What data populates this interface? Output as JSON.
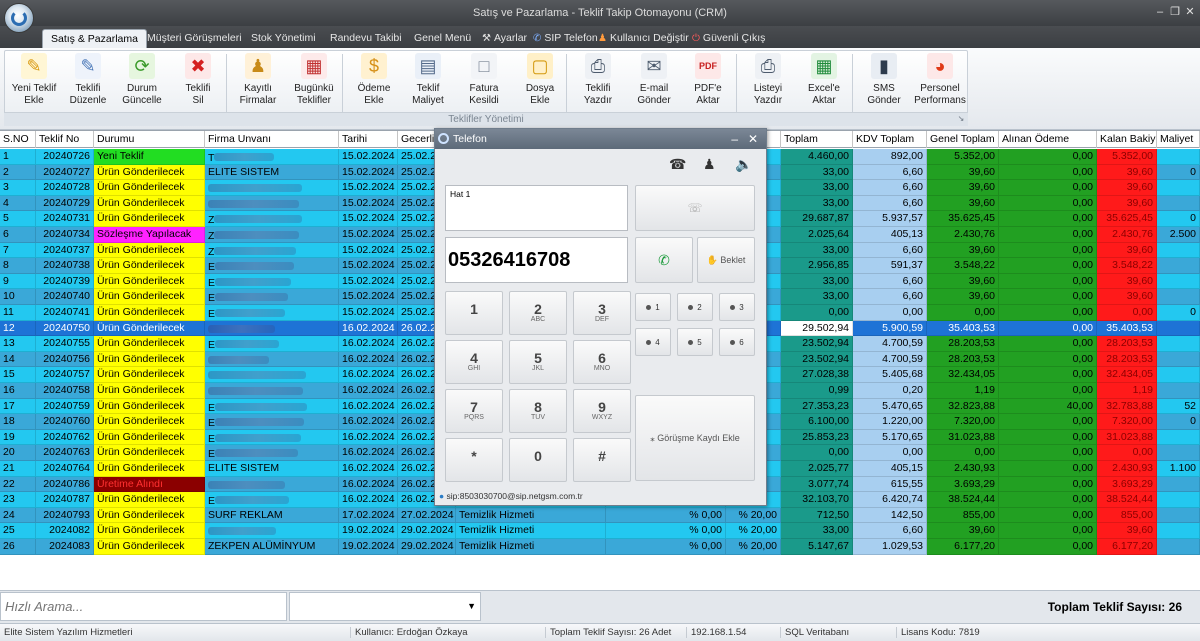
{
  "app": {
    "window_title": "Satış ve Pazarlama - Teklif Takip Otomayonu (CRM)",
    "accent": "#3b3e42"
  },
  "menu": {
    "tabs": [
      {
        "label": "Satış & Pazarlama",
        "active": true
      },
      {
        "label": "Müşteri Görüşmeleri"
      },
      {
        "label": "Stok Yönetimi"
      },
      {
        "label": "Randevu Takibi"
      },
      {
        "label": "Genel Menü"
      }
    ],
    "settings_label": "Ayarlar",
    "sip_label": "SIP Telefon",
    "switch_user_label": "Kullanıcı Değiştir",
    "logout_label": "Güvenli Çıkış"
  },
  "ribbon": {
    "group_caption": "Teklifler Yönetimi",
    "buttons": [
      {
        "label1": "Yeni Teklif",
        "label2": "Ekle",
        "icon": "add-document-icon"
      },
      {
        "label1": "Teklifi",
        "label2": "Düzenle",
        "icon": "pencil-icon"
      },
      {
        "label1": "Durum",
        "label2": "Güncelle",
        "icon": "refresh-icon"
      },
      {
        "label1": "Teklifi",
        "label2": "Sil",
        "icon": "delete-icon"
      },
      {
        "label1": "Kayıtlı",
        "label2": "Firmalar",
        "icon": "users-icon"
      },
      {
        "label1": "Bugünkü",
        "label2": "Teklifler",
        "icon": "calendar-icon"
      },
      {
        "label1": "Ödeme",
        "label2": "Ekle",
        "icon": "money-icon"
      },
      {
        "label1": "Teklif",
        "label2": "Maliyet",
        "icon": "calculator-icon"
      },
      {
        "label1": "Fatura",
        "label2": "Kesildi",
        "icon": "invoice-icon"
      },
      {
        "label1": "Dosya",
        "label2": "Ekle",
        "icon": "folder-icon"
      },
      {
        "label1": "Teklifi",
        "label2": "Yazdır",
        "icon": "print-icon"
      },
      {
        "label1": "E-mail",
        "label2": "Gönder",
        "icon": "email-icon"
      },
      {
        "label1": "PDF'e",
        "label2": "Aktar",
        "icon": "pdf-icon"
      },
      {
        "label1": "Listeyi",
        "label2": "Yazdır",
        "icon": "print-list-icon"
      },
      {
        "label1": "Excel'e",
        "label2": "Aktar",
        "icon": "excel-icon"
      },
      {
        "label1": "SMS",
        "label2": "Gönder",
        "icon": "phone-icon"
      },
      {
        "label1": "Personel",
        "label2": "Performans",
        "icon": "pie-chart-icon"
      }
    ]
  },
  "grid": {
    "columns": [
      "S.NO",
      "Teklif No",
      "Durumu",
      "Firma Unvanı",
      "Tarihi",
      "Gecerlil",
      "",
      "",
      "",
      "Toplam",
      "KDV Toplam",
      "Genel Toplam",
      "Alınan Ödeme",
      "Kalan Bakiye",
      "Maliyet"
    ],
    "rows": [
      {
        "sno": "1",
        "no": "20240726",
        "durum": "Yeni Teklif",
        "firma": "T",
        "tarih": "15.02.2024",
        "gec": "25.02.2",
        "toplam": "4.460,00",
        "kdv": "892,00",
        "genel": "5.352,00",
        "alinan": "0,00",
        "kalan": "5.352,00",
        "maliyet": ""
      },
      {
        "sno": "2",
        "no": "20240727",
        "durum": "Ürün Gönderilecek",
        "firma": "ELITE SISTEM",
        "tarih": "15.02.2024",
        "gec": "25.02.2",
        "toplam": "33,00",
        "kdv": "6,60",
        "genel": "39,60",
        "alinan": "0,00",
        "kalan": "39,60",
        "maliyet": "0"
      },
      {
        "sno": "3",
        "no": "20240728",
        "durum": "Ürün Gönderilecek",
        "firma": "",
        "tarih": "15.02.2024",
        "gec": "25.02.2",
        "toplam": "33,00",
        "kdv": "6,60",
        "genel": "39,60",
        "alinan": "0,00",
        "kalan": "39,60",
        "maliyet": ""
      },
      {
        "sno": "4",
        "no": "20240729",
        "durum": "Ürün Gönderilecek",
        "firma": "",
        "tarih": "15.02.2024",
        "gec": "25.02.2",
        "toplam": "33,00",
        "kdv": "6,60",
        "genel": "39,60",
        "alinan": "0,00",
        "kalan": "39,60",
        "maliyet": ""
      },
      {
        "sno": "5",
        "no": "20240731",
        "durum": "Ürün Gönderilecek",
        "firma": "Z",
        "tarih": "15.02.2024",
        "gec": "25.02.2",
        "toplam": "29.687,87",
        "kdv": "5.937,57",
        "genel": "35.625,45",
        "alinan": "0,00",
        "kalan": "35.625,45",
        "maliyet": "0"
      },
      {
        "sno": "6",
        "no": "20240734",
        "durum": "Sözleşme Yapılacak",
        "firma": "Z",
        "tarih": "15.02.2024",
        "gec": "25.02.2",
        "toplam": "2.025,64",
        "kdv": "405,13",
        "genel": "2.430,76",
        "alinan": "0,00",
        "kalan": "2.430,76",
        "maliyet": "2.500"
      },
      {
        "sno": "7",
        "no": "20240737",
        "durum": "Ürün Gönderilecek",
        "firma": "Z",
        "tarih": "15.02.2024",
        "gec": "25.02.2",
        "toplam": "33,00",
        "kdv": "6,60",
        "genel": "39,60",
        "alinan": "0,00",
        "kalan": "39,60",
        "maliyet": ""
      },
      {
        "sno": "8",
        "no": "20240738",
        "durum": "Ürün Gönderilecek",
        "firma": "E",
        "tarih": "15.02.2024",
        "gec": "25.02.2",
        "toplam": "2.956,85",
        "kdv": "591,37",
        "genel": "3.548,22",
        "alinan": "0,00",
        "kalan": "3.548,22",
        "maliyet": ""
      },
      {
        "sno": "9",
        "no": "20240739",
        "durum": "Ürün Gönderilecek",
        "firma": "E",
        "tarih": "15.02.2024",
        "gec": "25.02.2",
        "toplam": "33,00",
        "kdv": "6,60",
        "genel": "39,60",
        "alinan": "0,00",
        "kalan": "39,60",
        "maliyet": ""
      },
      {
        "sno": "10",
        "no": "20240740",
        "durum": "Ürün Gönderilecek",
        "firma": "E",
        "tarih": "15.02.2024",
        "gec": "25.02.2",
        "toplam": "33,00",
        "kdv": "6,60",
        "genel": "39,60",
        "alinan": "0,00",
        "kalan": "39,60",
        "maliyet": ""
      },
      {
        "sno": "11",
        "no": "20240741",
        "durum": "Ürün Gönderilecek",
        "firma": "E",
        "tarih": "15.02.2024",
        "gec": "25.02.2",
        "toplam": "0,00",
        "kdv": "0,00",
        "genel": "0,00",
        "alinan": "0,00",
        "kalan": "0,00",
        "maliyet": "0"
      },
      {
        "sno": "12",
        "no": "20240750",
        "durum": "Ürün Gönderilecek",
        "firma": "",
        "tarih": "16.02.2024",
        "gec": "26.02.2",
        "toplam": "29.502,94",
        "kdv": "5.900,59",
        "genel": "35.403,53",
        "alinan": "0,00",
        "kalan": "35.403,53",
        "maliyet": "",
        "selected": true
      },
      {
        "sno": "13",
        "no": "20240755",
        "durum": "Ürün Gönderilecek",
        "firma": "E",
        "tarih": "16.02.2024",
        "gec": "26.02.2",
        "toplam": "23.502,94",
        "kdv": "4.700,59",
        "genel": "28.203,53",
        "alinan": "0,00",
        "kalan": "28.203,53",
        "maliyet": ""
      },
      {
        "sno": "14",
        "no": "20240756",
        "durum": "Ürün Gönderilecek",
        "firma": "",
        "tarih": "16.02.2024",
        "gec": "26.02.2",
        "toplam": "23.502,94",
        "kdv": "4.700,59",
        "genel": "28.203,53",
        "alinan": "0,00",
        "kalan": "28.203,53",
        "maliyet": ""
      },
      {
        "sno": "15",
        "no": "20240757",
        "durum": "Ürün Gönderilecek",
        "firma": "",
        "tarih": "16.02.2024",
        "gec": "26.02.2",
        "toplam": "27.028,38",
        "kdv": "5.405,68",
        "genel": "32.434,05",
        "alinan": "0,00",
        "kalan": "32.434,05",
        "maliyet": ""
      },
      {
        "sno": "16",
        "no": "20240758",
        "durum": "Ürün Gönderilecek",
        "firma": "",
        "tarih": "16.02.2024",
        "gec": "26.02.2",
        "toplam": "0,99",
        "kdv": "0,20",
        "genel": "1,19",
        "alinan": "0,00",
        "kalan": "1,19",
        "maliyet": ""
      },
      {
        "sno": "17",
        "no": "20240759",
        "durum": "Ürün Gönderilecek",
        "firma": "E",
        "tarih": "16.02.2024",
        "gec": "26.02.2",
        "toplam": "27.353,23",
        "kdv": "5.470,65",
        "genel": "32.823,88",
        "alinan": "40,00",
        "kalan": "32.783,88",
        "maliyet": "52"
      },
      {
        "sno": "18",
        "no": "20240760",
        "durum": "Ürün Gönderilecek",
        "firma": "E",
        "tarih": "16.02.2024",
        "gec": "26.02.2",
        "toplam": "6.100,00",
        "kdv": "1.220,00",
        "genel": "7.320,00",
        "alinan": "0,00",
        "kalan": "7.320,00",
        "maliyet": "0"
      },
      {
        "sno": "19",
        "no": "20240762",
        "durum": "Ürün Gönderilecek",
        "firma": "E",
        "tarih": "16.02.2024",
        "gec": "26.02.2",
        "toplam": "25.853,23",
        "kdv": "5.170,65",
        "genel": "31.023,88",
        "alinan": "0,00",
        "kalan": "31.023,88",
        "maliyet": ""
      },
      {
        "sno": "20",
        "no": "20240763",
        "durum": "Ürün Gönderilecek",
        "firma": "E",
        "tarih": "16.02.2024",
        "gec": "26.02.2",
        "toplam": "0,00",
        "kdv": "0,00",
        "genel": "0,00",
        "alinan": "0,00",
        "kalan": "0,00",
        "maliyet": ""
      },
      {
        "sno": "21",
        "no": "20240764",
        "durum": "Ürün Gönderilecek",
        "firma": "ELITE SISTEM",
        "tarih": "16.02.2024",
        "gec": "26.02.2",
        "toplam": "2.025,77",
        "kdv": "405,15",
        "genel": "2.430,93",
        "alinan": "0,00",
        "kalan": "2.430,93",
        "maliyet": "1.100"
      },
      {
        "sno": "22",
        "no": "20240786",
        "durum": "Üretime Alındı",
        "firma": "",
        "tarih": "16.02.2024",
        "gec": "26.02.2",
        "toplam": "3.077,74",
        "kdv": "615,55",
        "genel": "3.693,29",
        "alinan": "0,00",
        "kalan": "3.693,29",
        "maliyet": ""
      },
      {
        "sno": "23",
        "no": "20240787",
        "durum": "Ürün Gönderilecek",
        "firma": "E",
        "tarih": "16.02.2024",
        "gec": "26.02.2",
        "toplam": "32.103,70",
        "kdv": "6.420,74",
        "genel": "38.524,44",
        "alinan": "0,00",
        "kalan": "38.524,44",
        "maliyet": ""
      },
      {
        "sno": "24",
        "no": "20240793",
        "durum": "Ürün Gönderilecek",
        "firma": "SURF REKLAM",
        "tarih": "17.02.2024",
        "gec": "27.02.2024",
        "hizmet": "Temizlik Hizmeti",
        "ind": "% 0,00",
        "kdvp": "% 20,00",
        "toplam": "712,50",
        "kdv": "142,50",
        "genel": "855,00",
        "alinan": "0,00",
        "kalan": "855,00",
        "maliyet": ""
      },
      {
        "sno": "25",
        "no": "2024082",
        "durum": "Ürün Gönderilecek",
        "firma": "",
        "tarih": "19.02.2024",
        "gec": "29.02.2024",
        "hizmet": "Temizlik Hizmeti",
        "ind": "% 0,00",
        "kdvp": "% 20,00",
        "toplam": "33,00",
        "kdv": "6,60",
        "genel": "39,60",
        "alinan": "0,00",
        "kalan": "39,60",
        "maliyet": ""
      },
      {
        "sno": "26",
        "no": "2024083",
        "durum": "Ürün Gönderilecek",
        "firma": "ZEKPEN ALÜMİNYUM",
        "tarih": "19.02.2024",
        "gec": "29.02.2024",
        "hizmet": "Temizlik Hizmeti",
        "ind": "% 0,00",
        "kdvp": "% 20,00",
        "toplam": "5.147,67",
        "kdv": "1.029,53",
        "genel": "6.177,20",
        "alinan": "0,00",
        "kalan": "6.177,20",
        "maliyet": ""
      }
    ],
    "partial_cells": {
      "kdv_pct_label": "00",
      "row12_left": "00"
    }
  },
  "phone": {
    "title": "Telefon",
    "line_label": "Hat 1",
    "number": "05326416708",
    "hold_label": "Beklet",
    "save_call_label": "Görüşme Kaydı Ekle",
    "sip_account": "sip:8503030700@sip.netgsm.com.tr",
    "keys": [
      {
        "d": "1",
        "s": ""
      },
      {
        "d": "2",
        "s": "ABC"
      },
      {
        "d": "3",
        "s": "DEF"
      },
      {
        "d": "4",
        "s": "GHI"
      },
      {
        "d": "5",
        "s": "JKL"
      },
      {
        "d": "6",
        "s": "MNO"
      },
      {
        "d": "7",
        "s": "PQRS"
      },
      {
        "d": "8",
        "s": "TUV"
      },
      {
        "d": "9",
        "s": "WXYZ"
      },
      {
        "d": "*",
        "s": ""
      },
      {
        "d": "0",
        "s": ""
      },
      {
        "d": "#",
        "s": ""
      }
    ],
    "lines": [
      "1",
      "2",
      "3",
      "4",
      "5",
      "6"
    ]
  },
  "bottom": {
    "search_placeholder": "Hızlı Arama...",
    "total_label": "Toplam Teklif Sayısı: 26"
  },
  "status": {
    "company": "Elite Sistem Yazılım Hizmetleri",
    "user": "Kullanıcı: Erdoğan Özkaya",
    "total": "Toplam Teklif Sayısı: 26 Adet",
    "ip": "192.168.1.54",
    "db": "SQL Veritabanı",
    "license": "Lisans Kodu: 7819"
  },
  "colors": {
    "row_blue_a": "#23c8f0",
    "row_blue_b": "#3aa8d8",
    "selected": "#1e73d6",
    "status_yellow": "#ffff00",
    "status_green": "#22dd22",
    "status_magenta": "#ff22ff",
    "status_darkred": "#8b0000",
    "total_teal": "#1a9a8a",
    "kdv_lightblue": "#a8cff0",
    "genel_green": "#22a022",
    "alinan_green": "#22a022",
    "kalan_red": "#ff1a1a"
  }
}
